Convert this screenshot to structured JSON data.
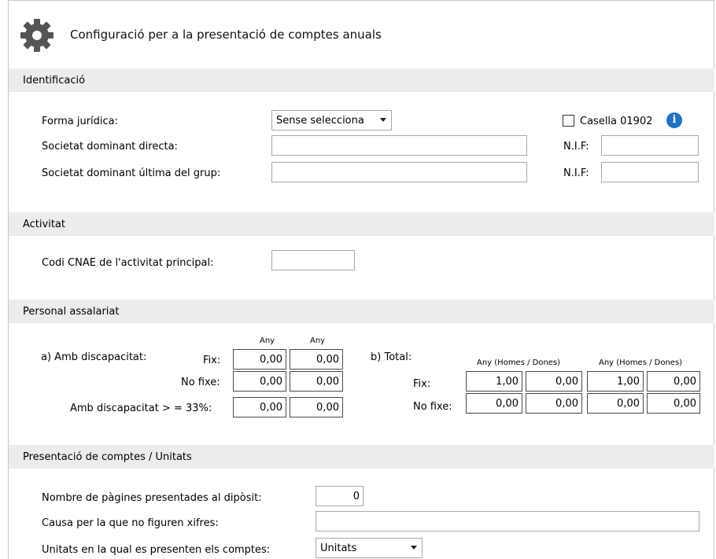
{
  "header": {
    "title": "Configuració per a la presentació de comptes anuals",
    "icon": "gear-icon"
  },
  "identificacio": {
    "section_title": "Identificació",
    "forma_juridica_label": "Forma jurídica:",
    "forma_juridica_value": "Sense selecciona",
    "casella_label": "Casella 01902",
    "casella_checked": false,
    "soc_directa_label": "Societat dominant directa:",
    "soc_directa_value": "",
    "soc_ultima_label": "Societat dominant última del grup:",
    "soc_ultima_value": "",
    "nif_label": "N.I.F:",
    "nif1_value": "",
    "nif2_value": ""
  },
  "activitat": {
    "section_title": "Activitat",
    "cnae_label": "Codi CNAE de l'activitat principal:",
    "cnae_value": ""
  },
  "personal": {
    "section_title": "Personal assalariat",
    "a_label": "a) Amb discapacitat:",
    "any_label": "Any",
    "fix_label": "Fix:",
    "nofixe_label": "No fixe:",
    "disc33_label": "Amb discapacitat > = 33%:",
    "a_fix": [
      "0,00",
      "0,00"
    ],
    "a_nofixe": [
      "0,00",
      "0,00"
    ],
    "a_disc33": [
      "0,00",
      "0,00"
    ],
    "b_label": "b) Total:",
    "any_hd_label": "Any (Homes / Dones)",
    "b_fix": [
      "1,00",
      "0,00",
      "1,00",
      "0,00"
    ],
    "b_nofixe": [
      "0,00",
      "0,00",
      "0,00",
      "0,00"
    ]
  },
  "presentacio": {
    "section_title": "Presentació de comptes / Unitats",
    "pagines_label": "Nombre de pàgines presentades al dipòsit:",
    "pagines_value": "0",
    "causa_label": "Causa per la que no figuren xifres:",
    "causa_value": "",
    "unitats_label": "Unitats en la qual es presenten els comptes:",
    "unitats_value": "Unitats"
  },
  "colors": {
    "section_bg": "#ececec",
    "info_blue": "#1f73c7"
  }
}
